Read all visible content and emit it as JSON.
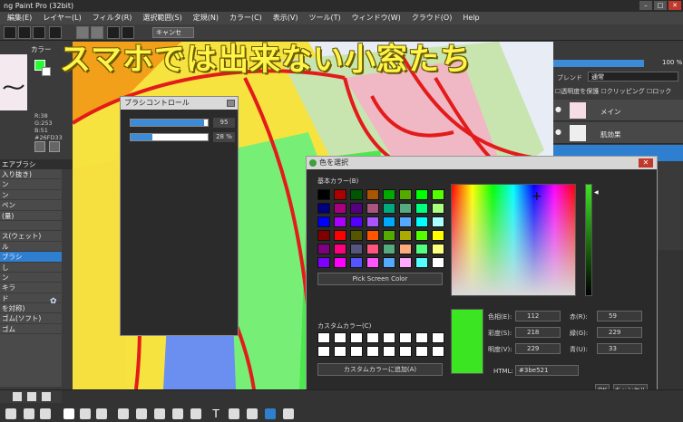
{
  "window": {
    "title": "ng Paint Pro (32bit)",
    "controls": [
      "–",
      "□",
      "✕"
    ]
  },
  "menu": [
    "編集(E)",
    "レイヤー(L)",
    "フィルタ(R)",
    "選択範囲(S)",
    "定規(N)",
    "カラー(C)",
    "表示(V)",
    "ツール(T)",
    "ウィンドウ(W)",
    "クラウド(O)",
    "Help"
  ],
  "toolbar": {
    "cancel_label": "キャンセ"
  },
  "headline": "スマホでは出来ない小窓たち",
  "left": {
    "color_tab": "カラー",
    "rgb": [
      "R:38",
      "G:253",
      "B:51"
    ],
    "hex": "#26FD33",
    "brush_tab": "エアブラシ",
    "brush_items": [
      "入り抜き)",
      "ン",
      "ン",
      "ペン",
      "(量)",
      "",
      "ス(ウェット)",
      "ル",
      "ブラシ",
      "し",
      "ン",
      "キラ",
      "ド",
      "を対称)",
      "ゴム(ソフト)",
      "ゴム"
    ]
  },
  "brush_control": {
    "title": "ブラシコントロール",
    "size_value": "95",
    "size_fill": 0.95,
    "opacity_value": "28 %",
    "opacity_fill": 0.28
  },
  "right": {
    "opacity_value": "100 %",
    "blend_label": "ブレンド",
    "blend_value": "通常",
    "checks": [
      "透明度を保護",
      "クリッピング",
      "ロック"
    ],
    "layers": [
      "メイン",
      "肌効果"
    ]
  },
  "color_dialog": {
    "title": "色を選択",
    "basic_label": "基本カラー(B)",
    "pick_screen": "Pick Screen Color",
    "custom_label": "カスタムカラー(C)",
    "add_custom": "カスタムカラーに追加(A)",
    "hue_label": "色相(E):",
    "hue": "112",
    "sat_label": "彩度(S):",
    "sat": "218",
    "val_label": "明度(V):",
    "val": "229",
    "red_label": "赤(R):",
    "red": "59",
    "green_label": "緑(G):",
    "green": "229",
    "blue_label": "青(U):",
    "blue": "33",
    "html_label": "HTML:",
    "html": "#3be521",
    "ok": "OK",
    "cancel": "キャンセル",
    "current_color": "#3be521"
  },
  "basic_colors": [
    "#000000",
    "#aa0000",
    "#005500",
    "#aa5500",
    "#00aa00",
    "#55aa00",
    "#00ff00",
    "#55ff00",
    "#00007f",
    "#aa007f",
    "#55007f",
    "#aa557f",
    "#00aa7f",
    "#55aa7f",
    "#00ff7f",
    "#aaff7f",
    "#0000ff",
    "#aa00ff",
    "#5500ff",
    "#aa55ff",
    "#00aaff",
    "#55aaff",
    "#00ffff",
    "#aaffff",
    "#7f0000",
    "#ff0000",
    "#555500",
    "#ff5500",
    "#55aa00",
    "#aaaa00",
    "#55ff00",
    "#ffff00",
    "#7f007f",
    "#ff007f",
    "#55557f",
    "#ff557f",
    "#55aa7f",
    "#ffaa7f",
    "#55ff7f",
    "#ffff7f",
    "#7f00ff",
    "#ff00ff",
    "#5555ff",
    "#ff55ff",
    "#55aaff",
    "#ffaaff",
    "#55ffff",
    "#ffffff"
  ]
}
